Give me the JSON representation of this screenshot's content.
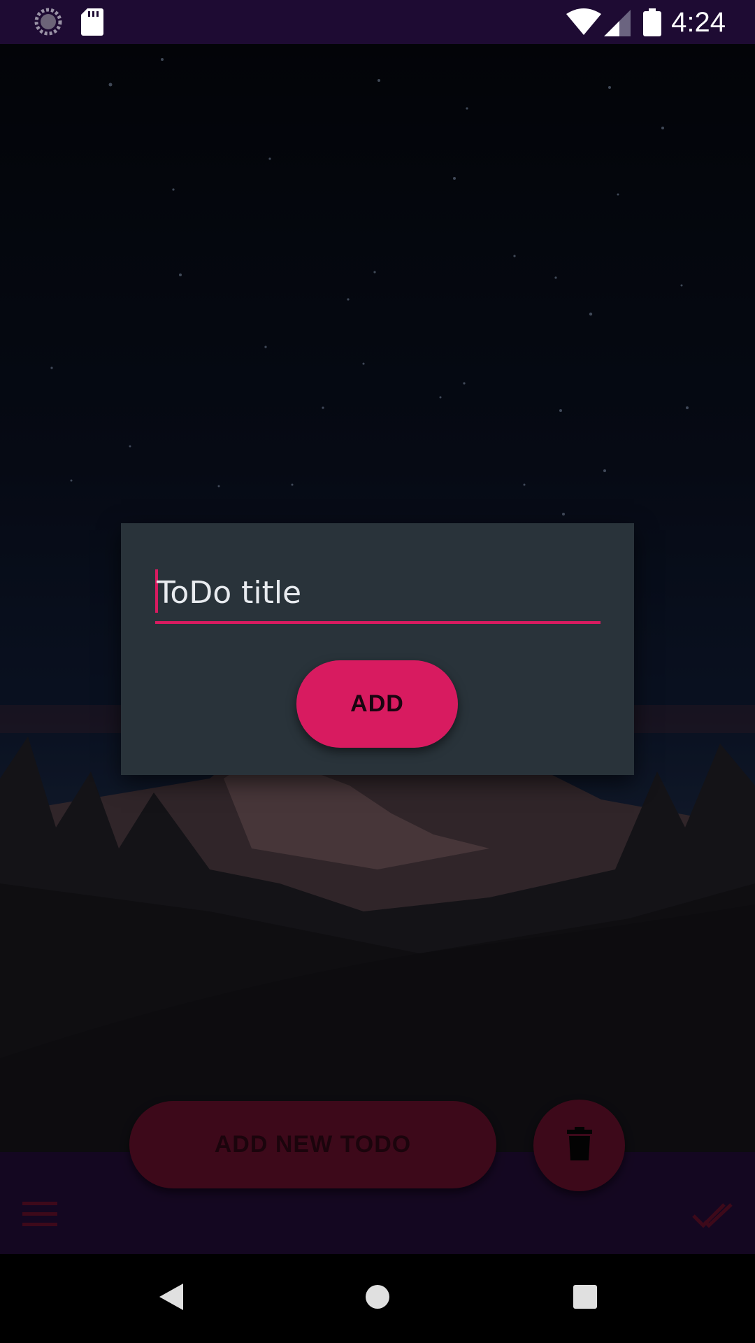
{
  "status_bar": {
    "time": "4:24",
    "icons": [
      "loading-circle-icon",
      "sd-card-icon",
      "wifi-icon",
      "cell-signal-icon",
      "battery-icon"
    ]
  },
  "dialog": {
    "title_input": {
      "placeholder": "ToDo title",
      "value": ""
    },
    "add_label": "ADD"
  },
  "main": {
    "add_new_todo_label": "ADD NEW TODO",
    "delete_icon": "trash-icon"
  },
  "bottom_bar": {
    "left_icon": "menu-icon",
    "right_icon": "done-all-icon"
  },
  "nav_bar": {
    "icons": [
      "back-icon",
      "home-icon",
      "recents-icon"
    ]
  },
  "colors": {
    "accent": "#d81b60",
    "status_bar": "#1e0b33",
    "bottom_bar": "#200c33",
    "dialog": "#29333a"
  }
}
